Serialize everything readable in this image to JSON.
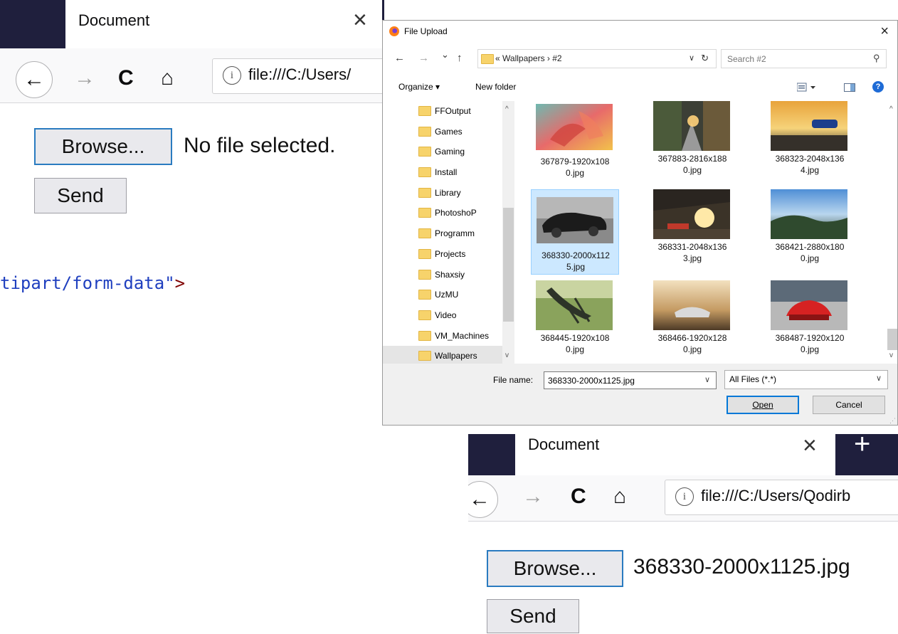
{
  "browser_before": {
    "tab_title": "Document",
    "tab_close": "×",
    "back": "←",
    "forward": "→",
    "reload": "C",
    "home": "⌂",
    "info": "i",
    "url": "file:///C:/Users/",
    "browse_label": "Browse...",
    "file_status": "No file selected.",
    "send_label": "Send"
  },
  "code_fragment": {
    "text": "tipart/form-data\"",
    "tag_end": ">"
  },
  "dialog": {
    "title": "File Upload",
    "close": "×",
    "nav": {
      "back": "←",
      "forward": "→",
      "recent": "⌄",
      "up": "↑"
    },
    "breadcrumb": "«  Wallpapers  ›  #2",
    "search_placeholder": "Search #2",
    "toolbar": {
      "organize": "Organize ▾",
      "new_folder": "New folder",
      "help": "?"
    },
    "folders": [
      "FFOutput",
      "Games",
      "Gaming",
      "Install",
      "Library",
      "PhotoshoP",
      "Programm",
      "Projects",
      "Shaxsiy",
      "UzMU",
      "Video",
      "VM_Machines",
      "Wallpapers"
    ],
    "files": [
      {
        "name": "367879-1920x1080.jpg",
        "line1": "367879-1920x108",
        "line2": "0.jpg"
      },
      {
        "name": "367883-2816x1880.jpg",
        "line1": "367883-2816x188",
        "line2": "0.jpg"
      },
      {
        "name": "368323-2048x1364.jpg",
        "line1": "368323-2048x136",
        "line2": "4.jpg"
      },
      {
        "name": "368330-2000x1125.jpg",
        "line1": "368330-2000x112",
        "line2": "5.jpg"
      },
      {
        "name": "368331-2048x1363.jpg",
        "line1": "368331-2048x136",
        "line2": "3.jpg"
      },
      {
        "name": "368421-2880x1800.jpg",
        "line1": "368421-2880x180",
        "line2": "0.jpg"
      },
      {
        "name": "368445-1920x1080.jpg",
        "line1": "368445-1920x108",
        "line2": "0.jpg"
      },
      {
        "name": "368466-1920x1280.jpg",
        "line1": "368466-1920x128",
        "line2": "0.jpg"
      },
      {
        "name": "368487-1920x1200.jpg",
        "line1": "368487-1920x120",
        "line2": "0.jpg"
      }
    ],
    "selected_file": "368330-2000x1125.jpg",
    "file_name_label": "File name:",
    "file_name_value": "368330-2000x1125.jpg",
    "file_type": "All Files (*.*)",
    "open_label": "Open",
    "cancel_label": "Cancel"
  },
  "browser_after": {
    "tab_title": "Document",
    "tab_close": "×",
    "new_tab": "+",
    "back": "←",
    "forward": "→",
    "reload": "C",
    "home": "⌂",
    "info": "i",
    "url": "file:///C:/Users/Qodirb",
    "browse_label": "Browse...",
    "file_status": "368330-2000x1125.jpg",
    "send_label": "Send"
  },
  "colors": {
    "dark_tab": "#1f1f3d",
    "focus_blue": "#2a7bc0",
    "code_string": "#1f3fbf",
    "code_tag": "#800000",
    "selection": "#cce8ff",
    "dialog_accent": "#0078d7"
  }
}
